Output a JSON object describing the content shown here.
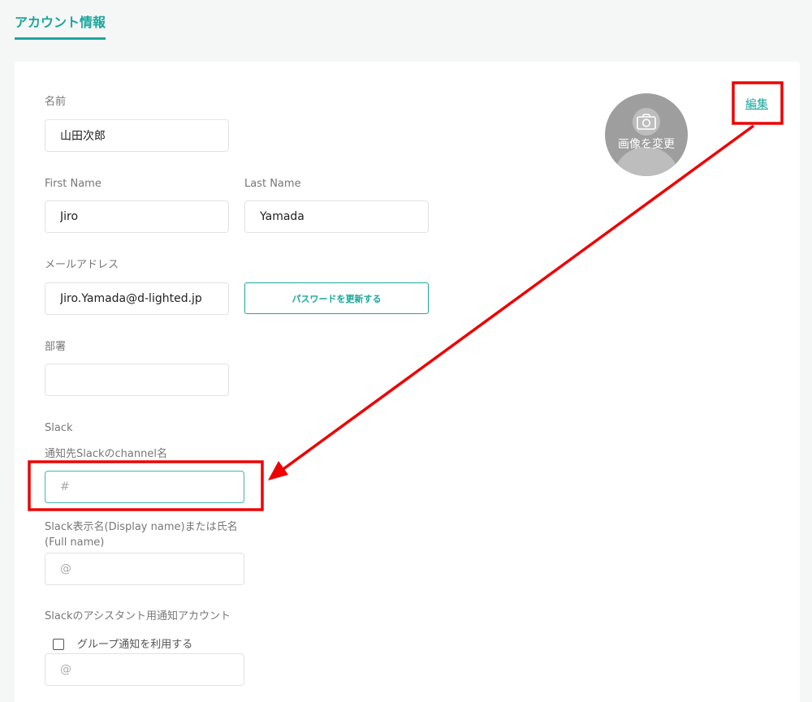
{
  "page": {
    "tab_title": "アカウント情報"
  },
  "avatar": {
    "change_label": "画像を変更"
  },
  "edit_link": "編集",
  "form": {
    "name": {
      "label": "名前",
      "value": "山田次郎"
    },
    "first_name": {
      "label": "First Name",
      "value": "Jiro"
    },
    "last_name": {
      "label": "Last Name",
      "value": "Yamada"
    },
    "email": {
      "label": "メールアドレス",
      "value": "Jiro.Yamada@d-lighted.jp"
    },
    "password_button": "パスワードを更新する",
    "department": {
      "label": "部署",
      "value": ""
    },
    "slack_section": "Slack",
    "slack_channel": {
      "label": "通知先Slackのchannel名",
      "placeholder": "#"
    },
    "slack_display_name": {
      "label": "Slack表示名(Display name)または氏名(Full name)",
      "placeholder": "@"
    },
    "slack_assistant": {
      "label": "Slackのアシスタント用通知アカウント",
      "placeholder": "@"
    },
    "group_notify": {
      "label": "グループ通知を利用する",
      "checked": false
    }
  },
  "colors": {
    "accent": "#1aa79c",
    "annotation": "#ee0000"
  }
}
